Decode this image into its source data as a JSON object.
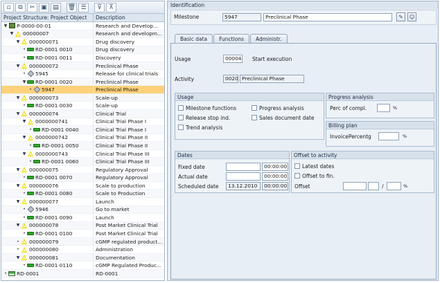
{
  "toolbar": {
    "icons": [
      "new-document-icon",
      "copy-icon",
      "cut-icon",
      "paste-icon",
      "paste-special-icon",
      "delete-icon",
      "list-icon",
      "expand-icon",
      "collapse-icon"
    ]
  },
  "tree": {
    "col_object": "Project Structure: Project Object",
    "col_desc": "Description",
    "rows": [
      {
        "indent": 0,
        "toggle": "▼",
        "icon": "project",
        "obj": "P-0000-00-01",
        "desc": "Research and Develop..."
      },
      {
        "indent": 1,
        "toggle": "▼",
        "icon": "triangle",
        "obj": "00000007",
        "desc": "Research and developm..."
      },
      {
        "indent": 2,
        "toggle": "▼",
        "icon": "triangle",
        "obj": "000000071",
        "desc": "Drug discovery"
      },
      {
        "indent": 3,
        "toggle": "•",
        "icon": "bar",
        "obj": "RD-0001 0010",
        "desc": "Drug discovery"
      },
      {
        "indent": 3,
        "toggle": "•",
        "icon": "bar",
        "obj": "RD-0001 0011",
        "desc": "Discovery"
      },
      {
        "indent": 2,
        "toggle": "▼",
        "icon": "triangle",
        "obj": "000000072",
        "desc": "Preclinical Phase"
      },
      {
        "indent": 3,
        "toggle": "•",
        "icon": "diamond",
        "obj": "5945",
        "desc": "Release for clinical trials"
      },
      {
        "indent": 3,
        "toggle": "▼",
        "icon": "bar",
        "obj": "RD-0001 0020",
        "desc": "Preclinical Phase"
      },
      {
        "indent": 4,
        "toggle": "•",
        "icon": "diamond",
        "obj": "5947",
        "desc": "Preclinical Phase",
        "selected": true
      },
      {
        "indent": 2,
        "toggle": "▼",
        "icon": "triangle",
        "obj": "000000073",
        "desc": "Scale-up"
      },
      {
        "indent": 3,
        "toggle": "•",
        "icon": "bar",
        "obj": "RD-0001 0030",
        "desc": "Scale-up"
      },
      {
        "indent": 2,
        "toggle": "▼",
        "icon": "triangle",
        "obj": "000000074",
        "desc": "Clinical Trial"
      },
      {
        "indent": 3,
        "toggle": "▼",
        "icon": "triangle",
        "obj": "0000000741",
        "desc": "Clinical Trial Phase I"
      },
      {
        "indent": 4,
        "toggle": "•",
        "icon": "bar",
        "obj": "RD-0001 0040",
        "desc": "Clinical Trial Phase I"
      },
      {
        "indent": 3,
        "toggle": "▼",
        "icon": "triangle",
        "obj": "0000000742",
        "desc": "Clinical Trial Phase II"
      },
      {
        "indent": 4,
        "toggle": "•",
        "icon": "bar",
        "obj": "RD-0001 0050",
        "desc": "Clinical Trial Phase II"
      },
      {
        "indent": 3,
        "toggle": "▼",
        "icon": "triangle",
        "obj": "0000000743",
        "desc": "Clinical Trial Phase III"
      },
      {
        "indent": 4,
        "toggle": "•",
        "icon": "bar",
        "obj": "RD-0001 0060",
        "desc": "Clinical Trial Phase III"
      },
      {
        "indent": 2,
        "toggle": "▼",
        "icon": "triangle",
        "obj": "000000075",
        "desc": "Regulatory Approval"
      },
      {
        "indent": 3,
        "toggle": "•",
        "icon": "bar",
        "obj": "RD-0001 0070",
        "desc": "Regulatory Approval"
      },
      {
        "indent": 2,
        "toggle": "▼",
        "icon": "triangle",
        "obj": "000000076",
        "desc": "Scale to production"
      },
      {
        "indent": 3,
        "toggle": "•",
        "icon": "bar",
        "obj": "RD-0001 0080",
        "desc": "Scale to Production"
      },
      {
        "indent": 2,
        "toggle": "▼",
        "icon": "triangle",
        "obj": "000000077",
        "desc": "Launch"
      },
      {
        "indent": 3,
        "toggle": "•",
        "icon": "diamond",
        "obj": "5946",
        "desc": "Go to market"
      },
      {
        "indent": 3,
        "toggle": "•",
        "icon": "bar",
        "obj": "RD-0001 0090",
        "desc": "Launch"
      },
      {
        "indent": 2,
        "toggle": "▼",
        "icon": "triangle",
        "obj": "000000078",
        "desc": "Post Market Clinical Trial"
      },
      {
        "indent": 3,
        "toggle": "•",
        "icon": "bar",
        "obj": "RD-0001 0100",
        "desc": "Post Market Clinical Trial"
      },
      {
        "indent": 2,
        "toggle": "•",
        "icon": "triangle",
        "obj": "000000079",
        "desc": "cGMP regulated product..."
      },
      {
        "indent": 2,
        "toggle": "•",
        "icon": "triangle",
        "obj": "000000080",
        "desc": "Administration"
      },
      {
        "indent": 2,
        "toggle": "▼",
        "icon": "triangle",
        "obj": "000000081",
        "desc": "Documentation"
      },
      {
        "indent": 3,
        "toggle": "•",
        "icon": "bar",
        "obj": "RD-0001 0110",
        "desc": "cGMP Regulated Produc..."
      },
      {
        "indent": 0,
        "toggle": "•",
        "icon": "wbs",
        "obj": "RD-0001",
        "desc": "RD-0001"
      }
    ]
  },
  "identification": {
    "title": "Identification",
    "milestone_label": "Milestone",
    "milestone_number": "5947",
    "milestone_desc": "Preclinical Phase"
  },
  "tabs": [
    "Basic data",
    "Functions",
    "Administr."
  ],
  "basic": {
    "usage_label": "Usage",
    "usage_value": "00004",
    "usage_text": "Start execution",
    "activity_label": "Activity",
    "activity_value": "0020",
    "activity_desc": "Preclinical Phase"
  },
  "usage_group": {
    "title": "Usage",
    "milestone_functions": "Milestone functions",
    "progress_analysis": "Progress analysis",
    "release_stop": "Release stop ind.",
    "sales_doc_date": "Sales document date",
    "trend_analysis": "Trend analysis"
  },
  "progress_group": {
    "title": "Progress analysis",
    "perc_label": "Perc of compl.",
    "perc_value": "",
    "unit": "%"
  },
  "billing_group": {
    "title": "Billing plan",
    "invoice_label": "InvoicePercentg",
    "invoice_value": "",
    "unit": "%"
  },
  "dates_group": {
    "title": "Dates",
    "fixed_label": "Fixed date",
    "fixed_date": "",
    "fixed_time": "00:00:00",
    "actual_label": "Actual date",
    "actual_date": "",
    "actual_time": "00:00:00",
    "sched_label": "Scheduled date",
    "sched_date": "13.12.2010",
    "sched_time": "00:00:00"
  },
  "offset_group": {
    "title": "Offset to activity",
    "latest_dates": "Latest dates",
    "offset_to_fin": "Offset to fin.",
    "offset_label": "Offset",
    "slash": "/",
    "unit": "%"
  }
}
